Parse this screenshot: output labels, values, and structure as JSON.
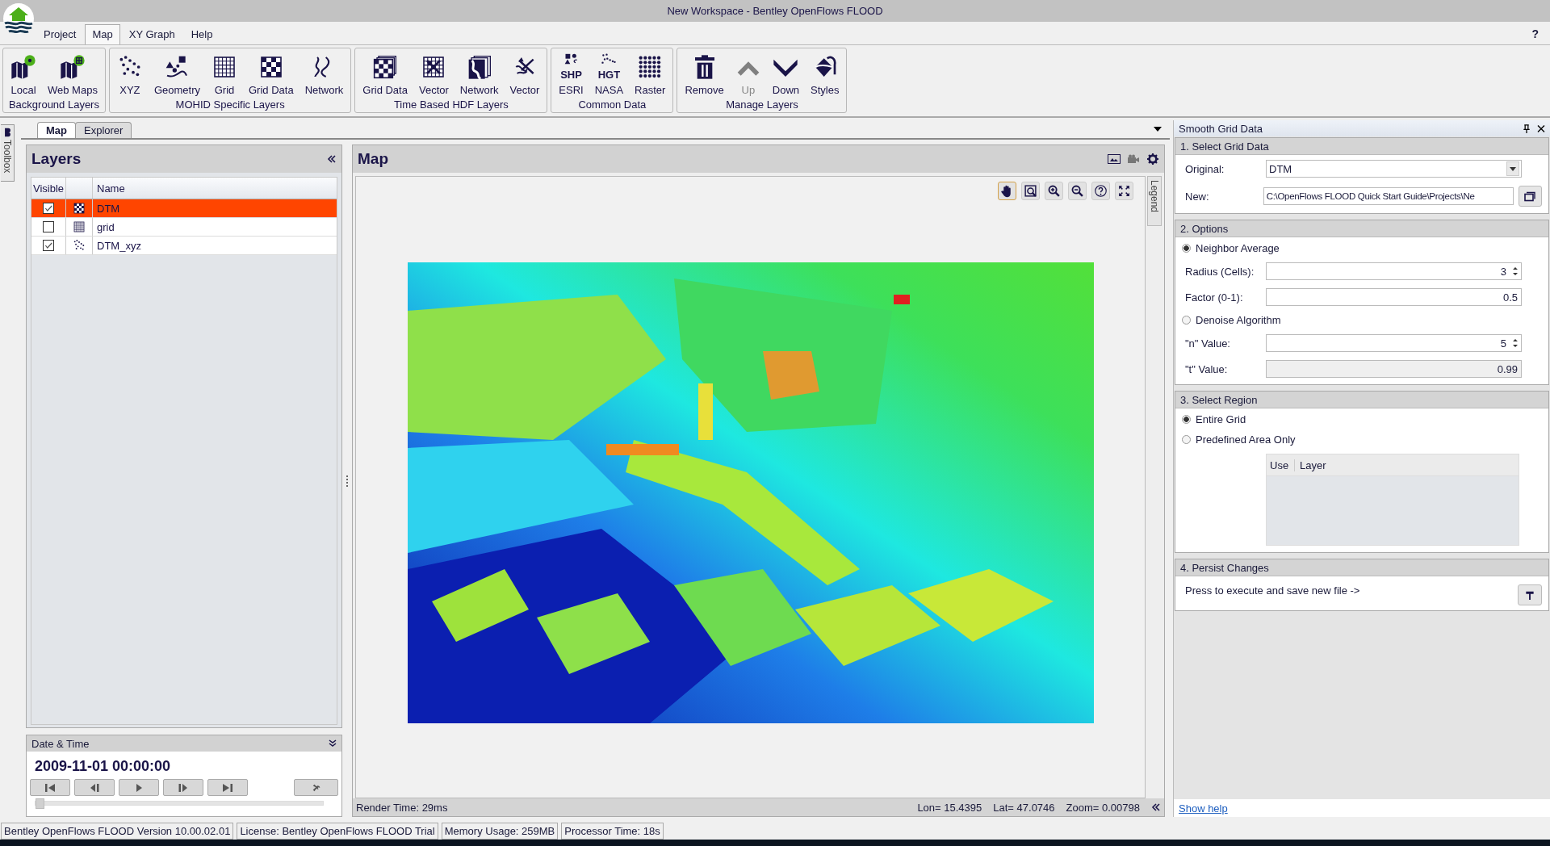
{
  "window": {
    "title": "New Workspace - Bentley OpenFlows FLOOD"
  },
  "menu": [
    {
      "label": "Project",
      "selected": false
    },
    {
      "label": "Map",
      "selected": true
    },
    {
      "label": "XY Graph",
      "selected": false
    },
    {
      "label": "Help",
      "selected": false
    }
  ],
  "help_button": "?",
  "ribbon": [
    {
      "group": "Background Layers",
      "buttons": [
        {
          "label": "Local",
          "kind": "local",
          "disabled": false
        },
        {
          "label": "Web Maps",
          "kind": "webmaps",
          "disabled": false
        }
      ]
    },
    {
      "group": "MOHID Specific Layers",
      "buttons": [
        {
          "label": "XYZ",
          "kind": "xyz",
          "disabled": false
        },
        {
          "label": "Geometry",
          "kind": "geometry",
          "disabled": false
        },
        {
          "label": "Grid",
          "kind": "grid",
          "disabled": false
        },
        {
          "label": "Grid Data",
          "kind": "griddata",
          "disabled": false
        },
        {
          "label": "Network",
          "kind": "network",
          "disabled": false
        }
      ]
    },
    {
      "group": "Time Based HDF Layers",
      "buttons": [
        {
          "label": "Grid Data",
          "kind": "hdf-griddata",
          "disabled": false
        },
        {
          "label": "Vector",
          "kind": "hdf-vector",
          "disabled": false
        },
        {
          "label": "Network",
          "kind": "hdf-network",
          "disabled": false
        },
        {
          "label": "Vector",
          "kind": "hdf-vector2",
          "disabled": false
        }
      ]
    },
    {
      "group": "Common Data",
      "buttons": [
        {
          "label": "ESRI",
          "kind": "esri",
          "icon_text": "SHP",
          "disabled": false
        },
        {
          "label": "NASA",
          "kind": "nasa",
          "icon_text": "HGT",
          "disabled": false
        },
        {
          "label": "Raster",
          "kind": "raster",
          "disabled": false
        }
      ]
    },
    {
      "group": "Manage Layers",
      "buttons": [
        {
          "label": "Remove",
          "kind": "remove",
          "disabled": false
        },
        {
          "label": "Up",
          "kind": "up",
          "disabled": true
        },
        {
          "label": "Down",
          "kind": "down",
          "disabled": false
        },
        {
          "label": "Styles",
          "kind": "styles",
          "disabled": false
        }
      ]
    }
  ],
  "toolbox_tab": "Toolbox",
  "doc_tabs": [
    {
      "label": "Map",
      "selected": true
    },
    {
      "label": "Explorer",
      "selected": false
    }
  ],
  "layers": {
    "title": "Layers",
    "columns": [
      "Visible",
      "Name"
    ],
    "rows": [
      {
        "name": "DTM",
        "kind": "griddata",
        "visible": true,
        "selected": true
      },
      {
        "name": "grid",
        "kind": "grid",
        "visible": false,
        "selected": false
      },
      {
        "name": "DTM_xyz",
        "kind": "xyz",
        "visible": true,
        "selected": false
      }
    ]
  },
  "date_time": {
    "title": "Date & Time",
    "value": "2009-11-01 00:00:00",
    "slider": {
      "level": 0
    }
  },
  "map": {
    "title": "Map",
    "legend_tab": "Legend",
    "tools": [
      {
        "kind": "pan",
        "selected": true
      },
      {
        "kind": "zoom-box",
        "selected": false
      },
      {
        "kind": "zoom-in",
        "selected": false
      },
      {
        "kind": "zoom-out",
        "selected": false
      },
      {
        "kind": "help",
        "selected": false
      },
      {
        "kind": "full-extent",
        "selected": false
      }
    ],
    "render_time": "Render Time: 29ms",
    "lon": "Lon= 15.4395",
    "lat": "Lat= 47.0746",
    "zoom": "Zoom= 0.00798"
  },
  "smooth_panel": {
    "title": "Smooth Grid Data",
    "select": {
      "heading": "1. Select Grid Data",
      "original_label": "Original:",
      "original_value": "DTM",
      "new_label": "New:",
      "new_value": "C:\\OpenFlows FLOOD Quick Start Guide\\Projects\\Ne"
    },
    "options": {
      "heading": "2. Options",
      "methods": [
        {
          "label": "Neighbor Average",
          "selected": true,
          "fields": [
            {
              "label": "Radius (Cells):",
              "value": "3",
              "kind": "spin",
              "disabled": false
            },
            {
              "label": "Factor (0-1):",
              "value": "0.5",
              "kind": "text",
              "disabled": false
            }
          ]
        },
        {
          "label": "Denoise Algorithm",
          "selected": false,
          "fields": [
            {
              "label": "\"n\" Value:",
              "value": "5",
              "kind": "spin",
              "disabled": false
            },
            {
              "label": "\"t\" Value:",
              "value": "0.99",
              "kind": "text",
              "disabled": true
            }
          ]
        }
      ]
    },
    "region": {
      "heading": "3. Select Region",
      "choices": [
        {
          "label": "Entire Grid",
          "selected": true
        },
        {
          "label": "Predefined Area Only",
          "selected": false
        }
      ],
      "columns": [
        "Use",
        "Layer"
      ]
    },
    "persist": {
      "heading": "4. Persist Changes",
      "text": "Press to execute and save new file ->"
    },
    "show_help": "Show help"
  },
  "status_bar": [
    "Bentley OpenFlows FLOOD Version 10.00.02.01",
    "License: Bentley OpenFlows FLOOD Trial",
    "Memory Usage: 259MB",
    "Processor Time: 18s"
  ]
}
